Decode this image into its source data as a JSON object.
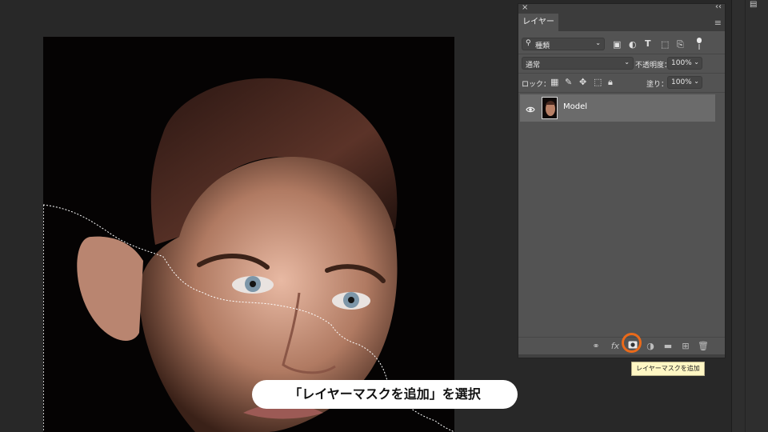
{
  "panel": {
    "close_glyph": "×",
    "collapse_glyph": "‹‹",
    "tab_label": "レイヤー",
    "menu_glyph": "≡",
    "filter": {
      "label": "種類"
    },
    "blend_mode": "通常",
    "opacity_label": "不透明度：",
    "opacity_value": "100%",
    "lock_label": "ロック：",
    "fill_label": "塗り：",
    "fill_value": "100%",
    "layer": {
      "name": "Model",
      "visible": true
    }
  },
  "bottom_icons": [
    "link-icon",
    "fx-icon",
    "add-mask-icon",
    "adjustment-icon",
    "folder-icon",
    "new-layer-icon",
    "trash-icon"
  ],
  "bottom_fx_label": "fx",
  "tooltip": "レイヤーマスクを追加",
  "caption": "「レイヤーマスクを追加」を選択",
  "accent_color": "#ea6a1a"
}
